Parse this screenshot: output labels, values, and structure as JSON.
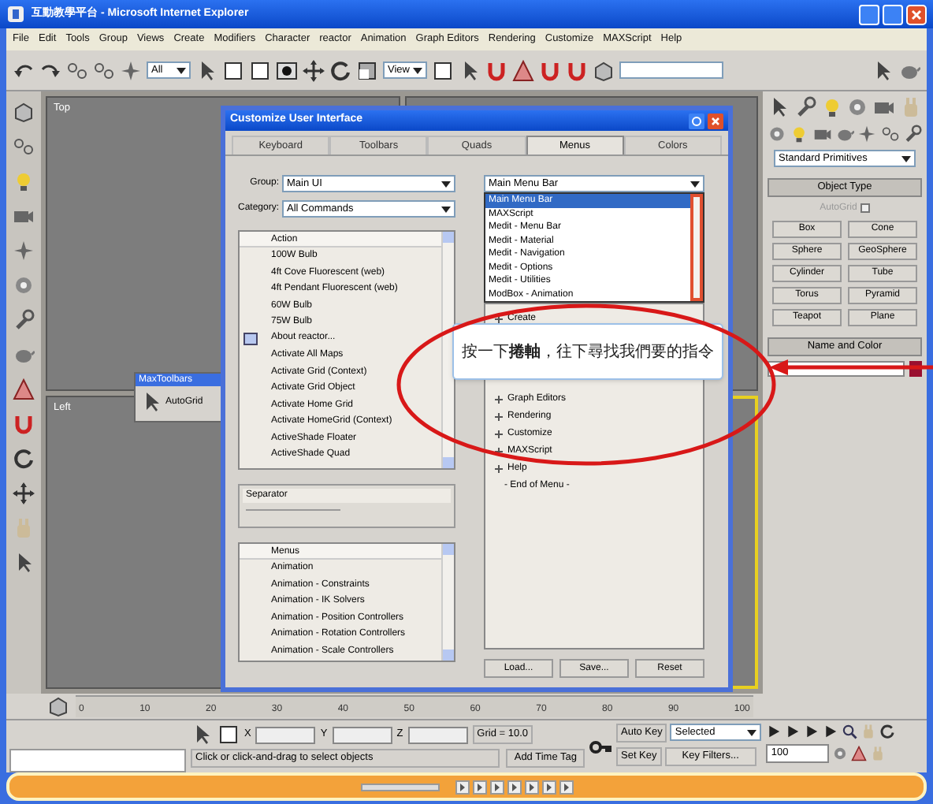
{
  "window": {
    "title": "互動教學平台 - Microsoft Internet Explorer"
  },
  "menu_bar": [
    "File",
    "Edit",
    "Tools",
    "Group",
    "Views",
    "Create",
    "Modifiers",
    "Character",
    "reactor",
    "Animation",
    "Graph Editors",
    "Rendering",
    "Customize",
    "MAXScript",
    "Help"
  ],
  "toolbar": {
    "selection_filter": "All",
    "reference_coord": "View"
  },
  "viewports": [
    {
      "label": "Top"
    },
    {
      "label": "Left"
    }
  ],
  "floating_toolbar": {
    "title": "MaxToolbars",
    "button": "AutoGrid"
  },
  "dialog": {
    "title": "Customize User Interface",
    "tabs": [
      {
        "label": "Keyboard",
        "selected": false
      },
      {
        "label": "Toolbars",
        "selected": false
      },
      {
        "label": "Quads",
        "selected": false
      },
      {
        "label": "Menus",
        "selected": true
      },
      {
        "label": "Colors",
        "selected": false
      }
    ],
    "group_label": "Group:",
    "group_value": "Main UI",
    "category_label": "Category:",
    "category_value": "All Commands",
    "actions": [
      {
        "label": "Action",
        "kind": "header"
      },
      {
        "label": "100W Bulb",
        "kind": "item"
      },
      {
        "label": "4ft Cove Fluorescent (web)",
        "kind": "item"
      },
      {
        "label": "4ft Pendant Fluorescent (web)",
        "kind": "item"
      },
      {
        "label": "60W Bulb",
        "kind": "item"
      },
      {
        "label": "75W Bulb",
        "kind": "item"
      },
      {
        "label": "About reactor...",
        "kind": "icon_item"
      },
      {
        "label": "Activate All Maps",
        "kind": "item"
      },
      {
        "label": "Activate Grid (Context)",
        "kind": "item"
      },
      {
        "label": "Activate Grid Object",
        "kind": "item"
      },
      {
        "label": "Activate Home Grid",
        "kind": "item"
      },
      {
        "label": "Activate HomeGrid (Context)",
        "kind": "item"
      },
      {
        "label": "ActiveShade Floater",
        "kind": "item"
      },
      {
        "label": "ActiveShade Quad",
        "kind": "item"
      }
    ],
    "separator": "Separator",
    "menus": [
      {
        "label": "Menus",
        "kind": "header"
      },
      {
        "label": "Animation",
        "kind": "item"
      },
      {
        "label": "Animation - Constraints",
        "kind": "item"
      },
      {
        "label": "Animation - IK Solvers",
        "kind": "item"
      },
      {
        "label": "Animation - Position Controllers",
        "kind": "item"
      },
      {
        "label": "Animation - Rotation Controllers",
        "kind": "item"
      },
      {
        "label": "Animation - Scale Controllers",
        "kind": "item"
      }
    ],
    "menu_dropdown": {
      "value": "Main Menu Bar",
      "options": [
        {
          "label": "Main Menu Bar",
          "selected": true
        },
        {
          "label": "MAXScript",
          "selected": false
        },
        {
          "label": "Medit - Menu Bar",
          "selected": false
        },
        {
          "label": "Medit - Material",
          "selected": false
        },
        {
          "label": "Medit - Navigation",
          "selected": false
        },
        {
          "label": "Medit - Options",
          "selected": false
        },
        {
          "label": "Medit - Utilities",
          "selected": false
        },
        {
          "label": "ModBox - Animation",
          "selected": false
        }
      ]
    },
    "menu_tree": [
      {
        "label": "Create",
        "kind": "branch"
      },
      {
        "label": "Graph Editors",
        "kind": "branch"
      },
      {
        "label": "Rendering",
        "kind": "branch"
      },
      {
        "label": "Customize",
        "kind": "branch"
      },
      {
        "label": "MAXScript",
        "kind": "branch"
      },
      {
        "label": "Help",
        "kind": "branch"
      },
      {
        "label": "- End of Menu -",
        "kind": "end"
      }
    ],
    "buttons": [
      "Load...",
      "Save...",
      "Reset"
    ]
  },
  "callout": {
    "text": "按一下**捲軸**，往下尋找我們要的指令"
  },
  "command_panel": {
    "category": "Standard Primitives",
    "object_type": "Object Type",
    "autogrid": {
      "label": "AutoGrid",
      "checked": false
    },
    "buttons": [
      "Box",
      "Cone",
      "Sphere",
      "GeoSphere",
      "Cylinder",
      "Tube",
      "Torus",
      "Pyramid",
      "Teapot",
      "Plane"
    ],
    "name_and_color": "Name and Color"
  },
  "timeline": {
    "ticks": [
      "0",
      "10",
      "20",
      "30",
      "40",
      "50",
      "60",
      "70",
      "80",
      "90",
      "100"
    ]
  },
  "status": {
    "x_label": "X",
    "y_label": "Y",
    "z_label": "Z",
    "grid": "Grid = 10.0",
    "prompt": "Click or click-and-drag to select objects",
    "add_time_tag": "Add Time Tag",
    "auto_key": "Auto Key",
    "key_mode": "Selected",
    "set_key": "Set Key",
    "key_filters": "Key Filters...",
    "frame": "100"
  }
}
